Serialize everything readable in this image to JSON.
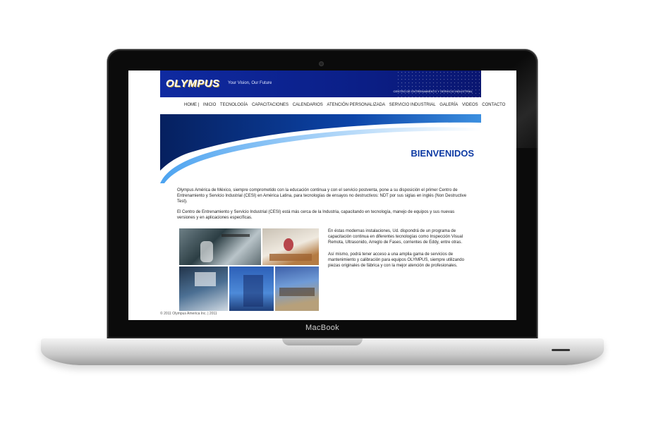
{
  "device": {
    "brand_label": "MacBook"
  },
  "site": {
    "logo": "OLYMPUS",
    "tagline": "Your Vision, Our Future",
    "center_label": "CENTRO DE ENTRENAMIENTO Y SERVICIO INDUSTRIAL",
    "nav": [
      "HOME |",
      "INICIO",
      "TECNOLOGÍA",
      "CAPACITACIONES",
      "CALENDARIOS",
      "ATENCIÓN PERSONALIZADA",
      "SERVICIO INDUSTRIAL",
      "GALERÍA",
      "VIDEOS",
      "CONTACTO"
    ],
    "welcome": "BIENVENIDOS",
    "intro": [
      "Olympus América de México, siempre comprometido con la educación continua y con el servicio postventa, pone a su disposición el primer Centro de Entrenamiento y Servicio Industrial (CESI) en América Latina, para tecnologías de ensayos no destructivos: NDT por sus siglas en inglés (Non Destructive Test).",
      "El Centro de Entrenamiento y Servicio Industrial (CESI) está más cerca de la Industria, capacitando en tecnología, manejo de equipos y sus nuevas versiones y en aplicaciones específicas."
    ],
    "side": [
      "En éstas modernas instalaciones, Ud. dispondrá de un programa de capacitación continua en diferentes tecnologías como Inspección Visual Remota, Ultrasonido, Arreglo de Fases, corrientes de Eddy, entre otras.",
      "Así mismo, podrá tener acceso a una amplia gama de servicios de mantenimiento y calibración para equipos OLYMPUS, siempre utilizando piezas originales de fábrica y con la mejor atención de profesionales."
    ],
    "footer": "© 2011 Olympus America Inc. | 2011",
    "colors": {
      "banner": "#0b1f88",
      "title": "#0d3aa3"
    }
  }
}
